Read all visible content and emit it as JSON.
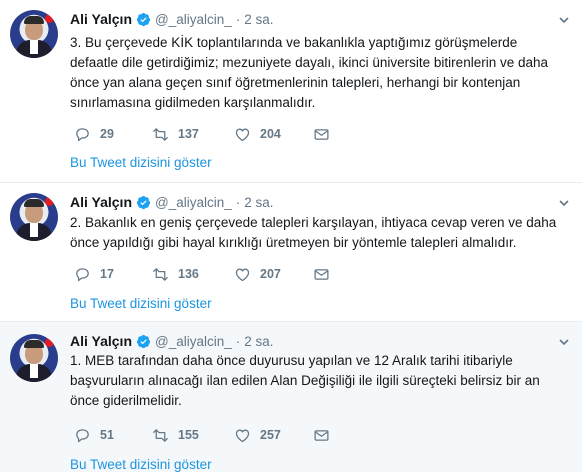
{
  "tweets": [
    {
      "author_name": "Ali Yalçın",
      "handle": "@_aliyalcin_",
      "separator": "·",
      "time": "2 sa.",
      "text": "3. Bu çerçevede KİK toplantılarında ve bakanlıkla yaptığımız görüşmelerde\ndefaatle  dile getirdiğimiz; mezuniyete dayalı, ikinci üniversite bitirenlerin ve daha\nönce yan alana geçen sınıf öğretmenlerinin talepleri, herhangi bir kontenjan\nsınırlamasına gidilmeden karşılanmalıdır.",
      "replies": "29",
      "retweets": "137",
      "likes": "204",
      "thread_link": "Bu Tweet dizisini göster"
    },
    {
      "author_name": "Ali Yalçın",
      "handle": "@_aliyalcin_",
      "separator": "·",
      "time": "2 sa.",
      "text": "2. Bakanlık en geniş çerçevede talepleri karşılayan, ihtiyaca cevap veren ve daha\nönce yapıldığı gibi hayal kırıklığı üretmeyen bir yöntemle talepleri almalıdır.",
      "replies": "17",
      "retweets": "136",
      "likes": "207",
      "thread_link": "Bu Tweet dizisini göster"
    },
    {
      "author_name": "Ali Yalçın",
      "handle": "@_aliyalcin_",
      "separator": "·",
      "time": "2 sa.",
      "text": "1. MEB tarafından daha önce duyurusu yapılan ve 12 Aralık tarihi itibariyle\nbaşvuruların alınacağı ilan edilen  Alan Değişiliği ile ilgili süreçteki belirsiz  bir an\nönce giderilmelidir.",
      "replies": "51",
      "retweets": "155",
      "likes": "257",
      "thread_link": "Bu Tweet dizisini göster"
    }
  ],
  "colors": {
    "accent": "#1b95e0",
    "muted": "#657786",
    "text": "#14171a",
    "verified": "#1da1f2",
    "divider": "#e6ecf0",
    "hover_bg": "#f5f8fa"
  },
  "icons": {
    "reply": "reply-icon",
    "retweet": "retweet-icon",
    "like": "heart-icon",
    "dm": "envelope-icon",
    "verified": "verified-badge-icon",
    "menu": "chevron-down-icon"
  }
}
